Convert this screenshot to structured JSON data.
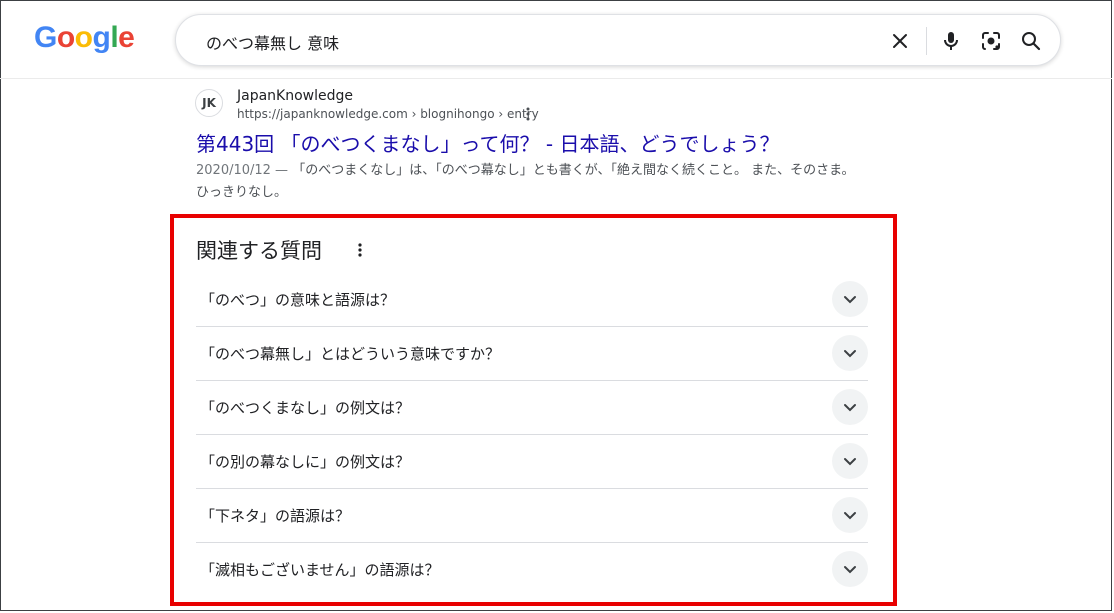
{
  "header": {
    "logo_letters": [
      {
        "ch": "G",
        "color": "#4285F4"
      },
      {
        "ch": "o",
        "color": "#EA4335"
      },
      {
        "ch": "o",
        "color": "#FBBC05"
      },
      {
        "ch": "g",
        "color": "#4285F4"
      },
      {
        "ch": "l",
        "color": "#34A853"
      },
      {
        "ch": "e",
        "color": "#EA4335"
      }
    ],
    "query": "のべつ幕無し 意味",
    "icons": [
      "clear-icon",
      "microphone-icon",
      "lens-icon",
      "search-icon"
    ]
  },
  "result": {
    "favicon_text": "JK",
    "site_name": "JapanKnowledge",
    "url": "https://japanknowledge.com › blognihongo › entry",
    "title": "第443回 「のべつくまなし」って何？ - 日本語、どうでしょう？",
    "snippet_date": "2020/10/12 — ",
    "snippet_text": "「のべつまくなし」は、「のべつ幕なし」とも書くが、「絶え間なく続くこと。 また、そのさま。 ひっきりなし。"
  },
  "paa": {
    "heading": "関連する質問",
    "questions": [
      "「のべつ」の意味と語源は？",
      "「のべつ幕無し」とはどういう意味ですか？",
      "「のべつくまなし」の例文は？",
      "「の別の幕なしに」の例文は？",
      "「下ネタ」の語源は？",
      "「滅相もございません」の語源は？"
    ]
  },
  "colors": {
    "link": "#1a0dab",
    "highlight": "#e80000"
  }
}
